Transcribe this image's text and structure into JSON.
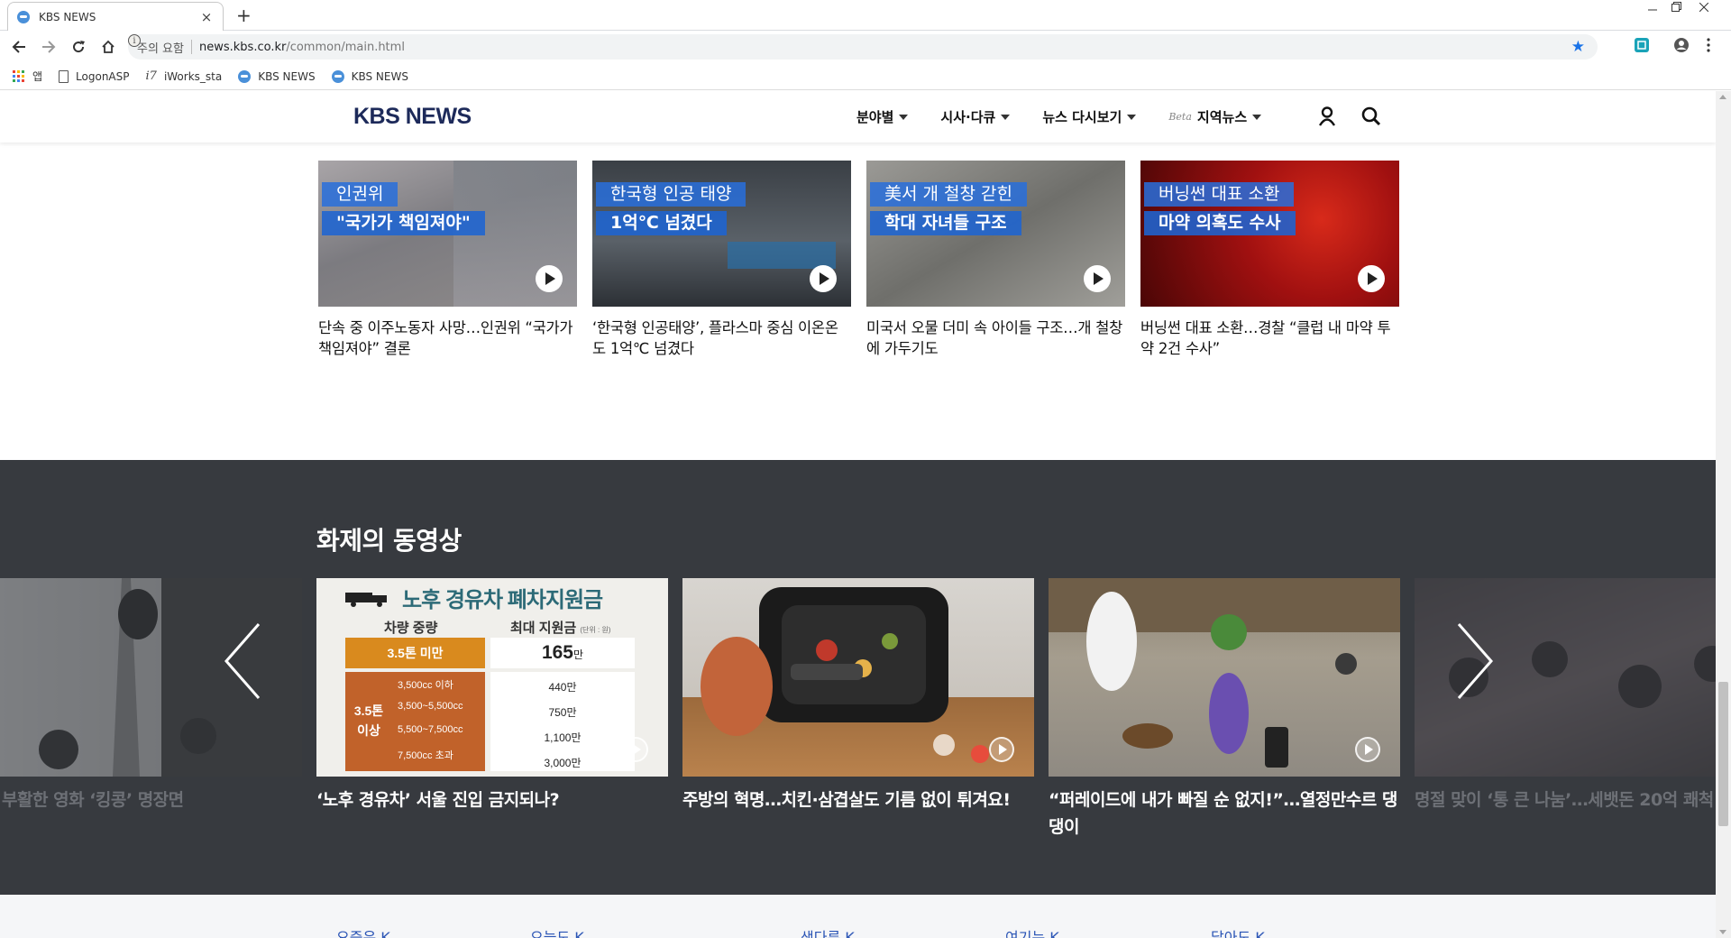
{
  "browser": {
    "tab_title": "KBS NEWS",
    "tab_close": "×",
    "new_tab": "+",
    "security_label": "주의 요함",
    "url_host": "news.kbs.co.kr",
    "url_path": "/common/main.html",
    "bookmarks": [
      {
        "label": "앱",
        "icon": "apps-grid-icon"
      },
      {
        "label": "LogonASP",
        "icon": "file-icon"
      },
      {
        "label": "iWorks_sta",
        "icon": "iworks-icon"
      },
      {
        "label": "KBS NEWS",
        "icon": "globe-icon"
      },
      {
        "label": "KBS NEWS",
        "icon": "globe-icon"
      }
    ],
    "accent_color": "#1a73e8"
  },
  "header": {
    "logo": "KBS NEWS",
    "menus": [
      {
        "label": "분야별"
      },
      {
        "label": "시사·다큐"
      },
      {
        "label": "뉴스 다시보기"
      },
      {
        "label": "지역뉴스",
        "badge": "Beta"
      }
    ],
    "logo_color": "#1d2a5a"
  },
  "news_cards": [
    {
      "cap1": "인권위",
      "cap2": "\"국가가 책임져야\"",
      "title": "단속 중 이주노동자 사망…인권위 “국가가 책임져야” 결론",
      "bg": "#8c8a8d"
    },
    {
      "cap1": "한국형 인공 태양",
      "cap2": "1억℃ 넘겼다",
      "title": "‘한국형 인공태양’, 플라스마 중심 이온온도 1억℃ 넘겼다",
      "bg": "#4e555c"
    },
    {
      "cap1": "美서 개 철창 갇힌",
      "cap2": "학대 자녀들 구조",
      "title": "미국서 오물 더미 속 아이들 구조…개 철창에 가두기도",
      "bg": "#8a8a86"
    },
    {
      "cap1": "버닝썬 대표 소환",
      "cap2": "마약 의혹도 수사",
      "title": "버닝썬 대표 소환…경찰 “클럽 내 마약 투약 2건 수사”",
      "bg": "#a81512"
    }
  ],
  "video_section": {
    "title": "화제의 동영상",
    "bg_color": "#373a3f",
    "cards": [
      {
        "title": "예술로 부활한 영화 ‘킹콩’ 명장면",
        "dim": true
      },
      {
        "title": "‘노후 경유차’ 서울 진입 금지되나?",
        "dim": false
      },
      {
        "title": "주방의 혁명…치킨·삼겹살도 기름 없이 튀겨요!",
        "dim": false
      },
      {
        "title": "“퍼레이드에 내가 빠질 순 없지!”…열정만수르 댕댕이",
        "dim": false
      },
      {
        "title": "명절 맞이 ‘통 큰 나눔’…세뱃돈 20억 쾌척",
        "dim": true
      }
    ],
    "infographic": {
      "title": "노후 경유차 폐차지원금",
      "col1": "차량 중량",
      "col2": "최대 지원금",
      "unit": "(단위 : 원)",
      "row1_label": "3.5톤 미만",
      "row1_value": "165",
      "row2_label_a": "3.5톤",
      "row2_label_b": "이상",
      "cc": [
        "3,500cc 이하",
        "3,500~5,500cc",
        "5,500~7,500cc",
        "7,500cc 초과"
      ],
      "values": [
        "440",
        "750",
        "1,100",
        "3,000"
      ],
      "suffix": "만"
    }
  },
  "footer_links": [
    "요즘은 K",
    "오늘도 K",
    "색다른 K",
    "여기는 K",
    "달아도 K"
  ]
}
